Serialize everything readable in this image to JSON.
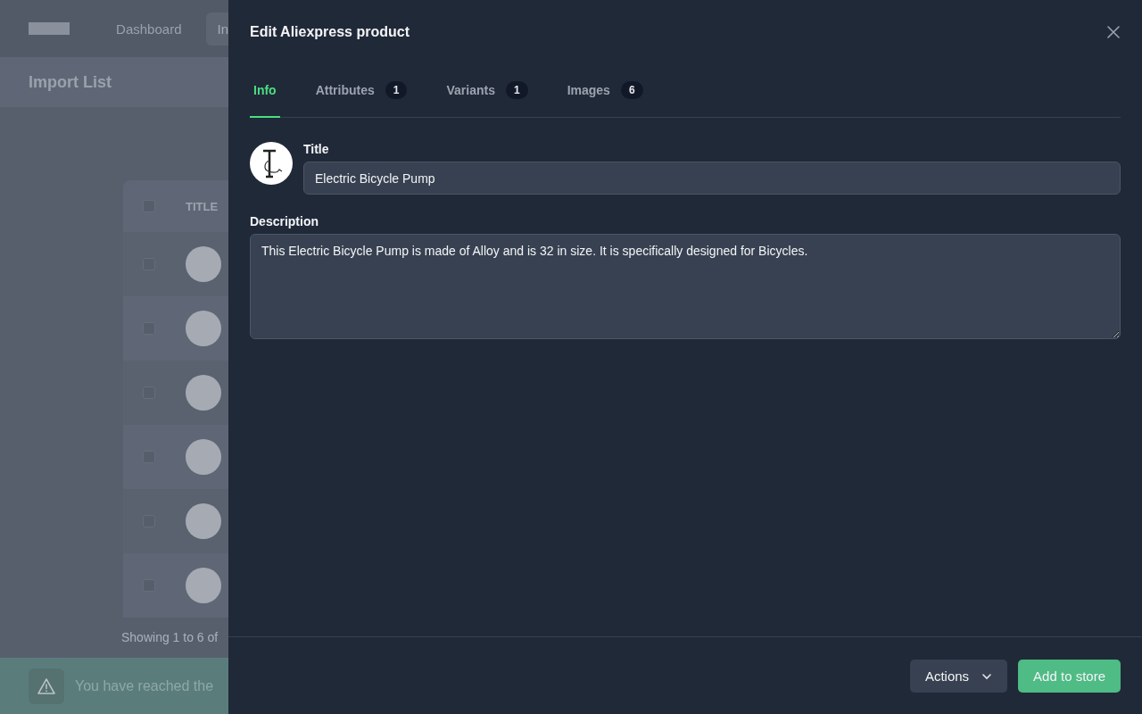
{
  "background_page": {
    "nav": [
      {
        "label": "Dashboard",
        "selected": false
      },
      {
        "label": "In",
        "selected": true
      }
    ],
    "header": {
      "title": "Import List"
    },
    "table": {
      "columns": [
        "TITLE"
      ],
      "header_checked": false,
      "rows": [
        {
          "checked": false
        },
        {
          "checked": false
        },
        {
          "checked": false
        },
        {
          "checked": false
        },
        {
          "checked": false
        },
        {
          "checked": false
        }
      ]
    },
    "pagination": "Showing 1 to 6 of",
    "banner": {
      "message": "You have reached the"
    }
  },
  "drawer": {
    "title": "Edit Aliexpress product",
    "tabs": [
      {
        "label": "Info",
        "selected": true
      },
      {
        "label": "Attributes",
        "count": "1",
        "selected": false
      },
      {
        "label": "Variants",
        "count": "1",
        "selected": false
      },
      {
        "label": "Images",
        "count": "6",
        "selected": false
      }
    ],
    "title_field": {
      "label": "Title",
      "value": "Electric Bicycle Pump"
    },
    "description_field": {
      "label": "Description",
      "value": "This Electric Bicycle Pump is made of Alloy and is 32 in size. It is specifically designed for Bicycles."
    },
    "buttons": [
      {
        "kind": "menu",
        "label": "Actions"
      },
      {
        "kind": "primary",
        "label": "Add to store"
      }
    ]
  }
}
